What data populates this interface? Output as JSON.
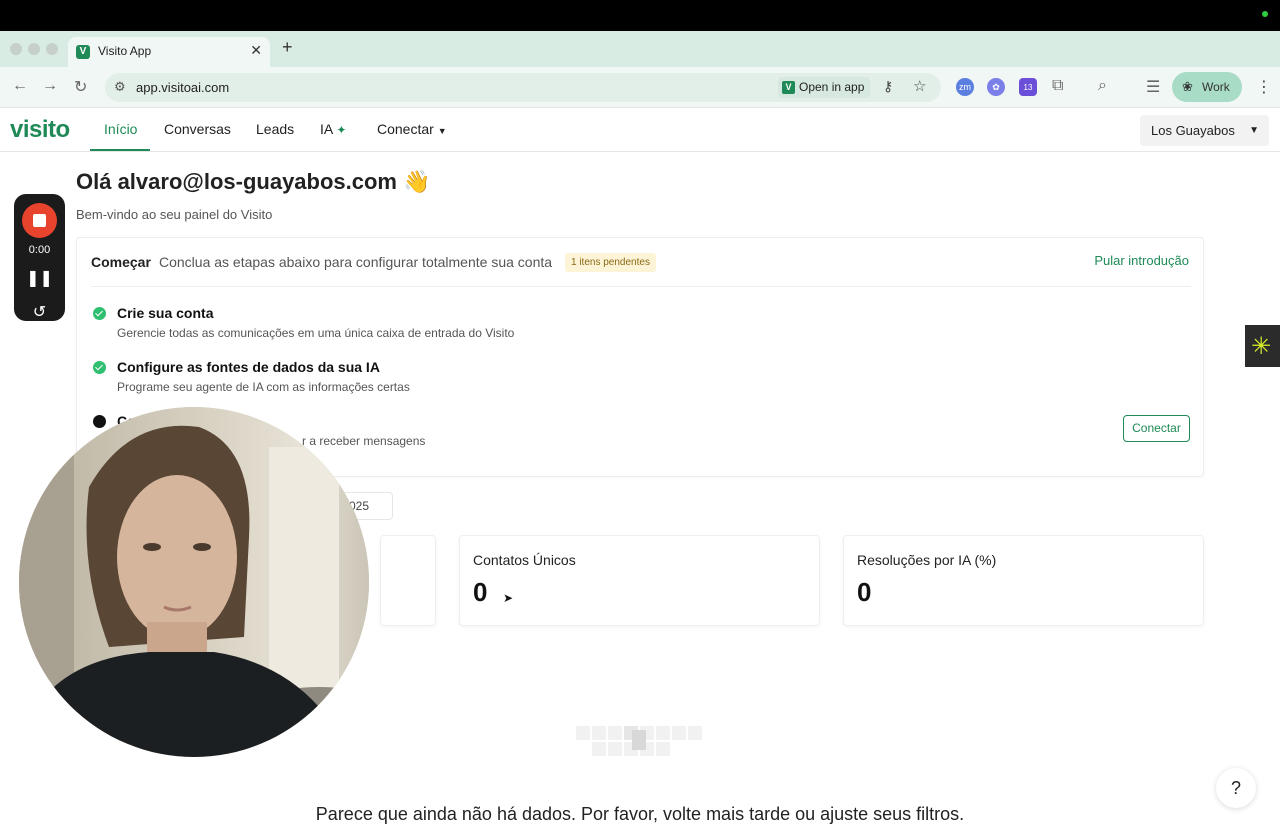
{
  "browser": {
    "tab_title": "Visito App",
    "tab_close": "✕",
    "new_tab": "+",
    "url": "app.visitoai.com",
    "open_in_app": "Open in app",
    "extension_badge": "13",
    "profile_label": "Work"
  },
  "nav": {
    "logo": "visito",
    "items": [
      {
        "label": "Início",
        "active": true
      },
      {
        "label": "Conversas"
      },
      {
        "label": "Leads"
      },
      {
        "label": "IA"
      },
      {
        "label": "Conectar"
      }
    ],
    "org_select": "Los Guayabos"
  },
  "greeting": {
    "title": "Olá alvaro@los-guayabos.com 👋",
    "subtitle": "Bem-vindo ao seu painel do Visito"
  },
  "onboarding": {
    "title": "Começar",
    "description": "Conclua as etapas abaixo para configurar totalmente sua conta",
    "pending_badge": "1 itens pendentes",
    "skip_link": "Pular introdução",
    "steps": [
      {
        "title": "Crie sua conta",
        "description": "Gerencie todas as comunicações em uma única caixa de entrada do Visito",
        "done": true
      },
      {
        "title": "Configure as fontes de dados da sua IA",
        "description": "Programe seu agente de IA com as informações certas",
        "done": true
      },
      {
        "title": "Co",
        "description": "r a receber mensagens",
        "done": false,
        "action": "Conectar"
      }
    ]
  },
  "date_filter_partial": "025",
  "stats": [
    {
      "label": "Contatos Únicos",
      "value": "0"
    },
    {
      "label": "Resoluções por IA (%)",
      "value": "0"
    }
  ],
  "empty_state": "Parece que ainda não há dados. Por favor, volte mais tarde ou ajuste seus filtros.",
  "recorder": {
    "time": "0:00"
  },
  "help_button": "?"
}
